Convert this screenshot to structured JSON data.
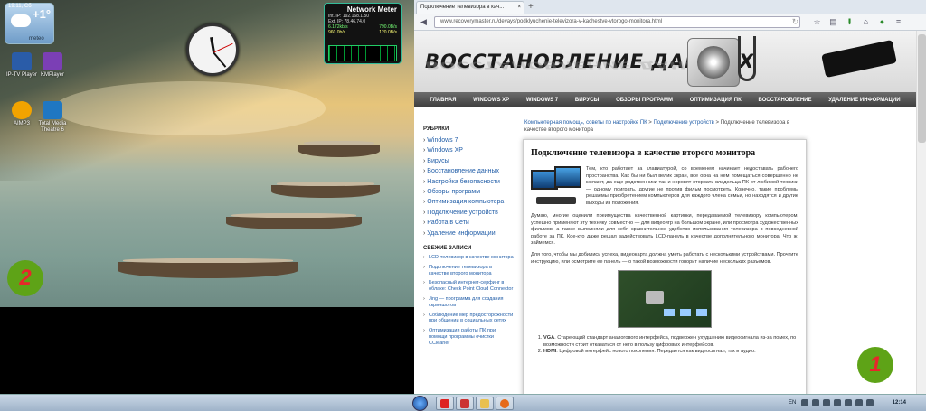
{
  "desktop": {
    "weather": {
      "time": "19:11, Сб",
      "temp": "+1°",
      "label": "meteo"
    },
    "icons": [
      {
        "label": "IP-TV Player",
        "color": "#2a5ca8"
      },
      {
        "label": "KMPlayer",
        "color": "#7b3fb5"
      },
      {
        "label": "AIMP3",
        "color": "#f2a300"
      },
      {
        "label": "Total Media Theatre 6",
        "color": "#1f77c2"
      }
    ],
    "network_meter": {
      "title": "Network Meter",
      "int_ip": "Int. IP: 192.168.1.50",
      "ext_ip": "Ext. IP: 78.46.74.0",
      "down": "6.172kb/s",
      "down2": "790.0B/s",
      "up": "960.0b/s",
      "up2": "120.0B/s"
    },
    "marker_left": "2",
    "marker_right": "1"
  },
  "browser": {
    "tab_title": "Подключение телевизора в кач...",
    "tab_close": "×",
    "new_tab": "+",
    "url": "www.recoverymaster.ru/devays/podklyuchenie-televizora-v-kachestve-vtorogo-monitora.html",
    "toolbar_icons": [
      "back-icon",
      "refresh-icon",
      "star-icon",
      "bookmarks-icon",
      "download-icon",
      "home-icon",
      "addon-icon",
      "menu-icon"
    ]
  },
  "site": {
    "logo": "ВОССТАНОВЛЕНИЕ ДАННЫХ",
    "menu": [
      "ГЛАВНАЯ",
      "WINDOWS XP",
      "WINDOWS 7",
      "ВИРУСЫ",
      "ОБЗОРЫ ПРОГРАММ",
      "ОПТИМИЗАЦИЯ ПК",
      "ВОССТАНОВЛЕНИЕ",
      "УДАЛЕНИЕ ИНФОРМАЦИИ"
    ],
    "sidebar": {
      "rubrics_title": "РУБРИКИ",
      "rubrics": [
        "Windows 7",
        "Windows XP",
        "Вирусы",
        "Восстановление данных",
        "Настройка безопасности",
        "Обзоры программ",
        "Оптимизация компьютера",
        "Подключение устройств",
        "Работа в Сети",
        "Удаление информации"
      ],
      "recent_title": "СВЕЖИЕ ЗАПИСИ",
      "recent": [
        "LCD-телевизор в качестве монитора",
        "Подключение телевизора в качестве второго монитора",
        "Безопасный интернет-серфинг в облаке: Check Point Cloud Connector",
        "Jing — программа для создания скриншотов",
        "Соблюдение мер предосторожности при общении в социальных сетях",
        "Оптимизация работы ПК при помощи программы очистки CCleaner"
      ]
    },
    "breadcrumb": {
      "home": "Компьютерная помощь, советы по настройке ПК",
      "sep": " > ",
      "cat": "Подключение устройств",
      "current": "Подключение телевизора в качестве второго монитора"
    },
    "article": {
      "title": "Подключение телевизора в качестве второго монитора",
      "p1": "Тем, кто работает за клавиатурой, со временем начинает недоставать рабочего пространства. Как бы ни был велик экран, все окна на нем помещаться совершенно не желают, да еще родственники так и норовят оторвать владельца ПК от любимой техники — одному поиграть, другие не против фильм посмотреть. Конечно, такие проблемы решаемы приобретением компьютеров для каждого члена семьи, но находятся и другие выходы из положения.",
      "p2": "Думаю, многие оценили преимущества качественной картинки, передаваемой телевизору компьютером, успешно применяют эту технику совместно — для видеоигр на большом экране, или просмотра художественных фильмов, а также выполняли для себя сравнительное удобство использования телевизора в повседневной работе за ПК. Кое-кто даже решал задействовать LCD-панель в качестве дополнительного монитора. Что ж, займемся.",
      "p3": "Для того, чтобы мы добились успеха, видеокарта должна уметь работать с несколькими устройствами. Прочтите инструкцию, или осмотрите ее панель — о такой возможности говорит наличие нескольких разъемов.",
      "li1_b": "VGA",
      "li1": ". Стареющий стандарт аналогового интерфейса, подвержен ухудшению видеосигнала из-за помех, по возможности стоит отказаться от него в пользу цифровых интерфейсов.",
      "li2_b": "HDMI",
      "li2": ". Цифровой интерфейс нового поколения. Передается как видеосигнал, так и аудио."
    }
  },
  "taskbar": {
    "lang": "EN",
    "time": "12:14"
  }
}
